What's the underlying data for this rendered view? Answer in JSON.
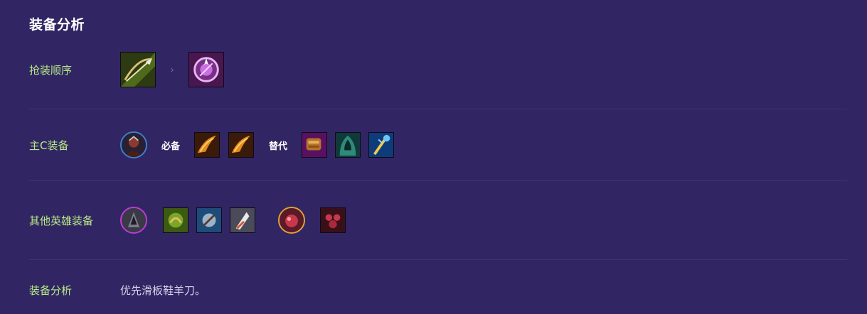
{
  "panel": {
    "title": "装备分析"
  },
  "rows": {
    "order": {
      "label": "抢装顺序",
      "items": [
        "弓弩",
        "紫色纹章"
      ],
      "separator": "›"
    },
    "main_c": {
      "label": "主C装备",
      "champion": "主C英雄头像",
      "required_tag": "必备",
      "required_items": [
        "烈焰刀",
        "烈焰刀"
      ],
      "alternative_tag": "替代",
      "alternative_items": [
        "紫色拳套",
        "绿色斗篷",
        "蓝色法杖"
      ]
    },
    "others": {
      "label": "其他英雄装备",
      "group1_champion": "紫框英雄头像",
      "group1_items": [
        "绿色装备",
        "蓝色装备",
        "白色羽刃"
      ],
      "group2_champion": "金框英雄头像",
      "group2_items": [
        "红色装备"
      ]
    },
    "analysis": {
      "label": "装备分析",
      "text": "优先滑板鞋羊刀。"
    }
  },
  "colors": {
    "background": "#312663",
    "label": "#b8e986",
    "divider": "#3f3475"
  }
}
